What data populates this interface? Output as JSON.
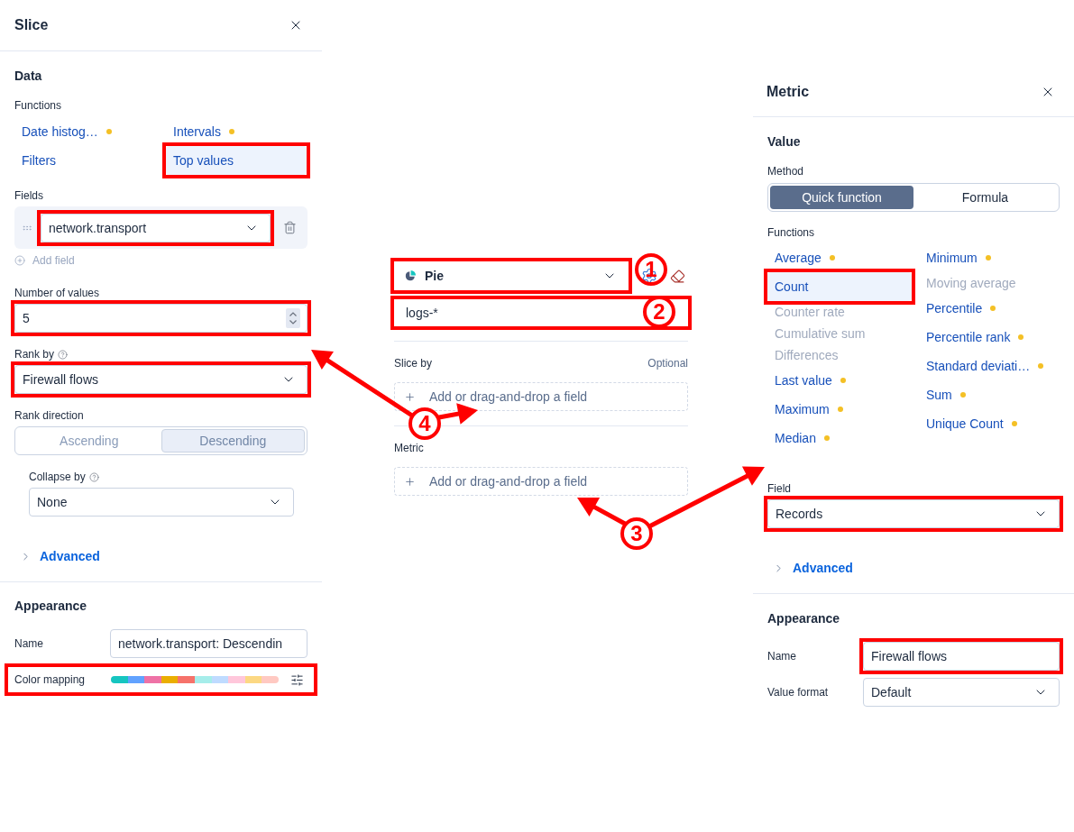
{
  "slice_panel": {
    "title": "Slice",
    "data_heading": "Data",
    "functions_label": "Functions",
    "functions": [
      {
        "label": "Date histog…",
        "dot": true,
        "selected": false,
        "highlighted": false
      },
      {
        "label": "Intervals",
        "dot": true,
        "selected": false,
        "highlighted": false
      },
      {
        "label": "Filters",
        "dot": false,
        "selected": false,
        "highlighted": false
      },
      {
        "label": "Top values",
        "dot": false,
        "selected": true,
        "highlighted": true
      }
    ],
    "fields_label": "Fields",
    "field": {
      "value": "network.transport",
      "highlighted": true
    },
    "add_field": "Add field",
    "number_of_values": {
      "label": "Number of values",
      "value": "5",
      "highlighted": true
    },
    "rank_by": {
      "label": "Rank by",
      "value": "Firewall flows",
      "highlighted": true
    },
    "rank_direction": {
      "label": "Rank direction",
      "disabled": true,
      "options": [
        {
          "label": "Ascending",
          "selected": false
        },
        {
          "label": "Descending",
          "selected": true
        }
      ]
    },
    "collapse_by": {
      "label": "Collapse by",
      "value": "None"
    },
    "advanced": {
      "label": "Advanced",
      "expanded": false
    },
    "appearance_heading": "Appearance",
    "name": {
      "label": "Name",
      "value": "network.transport: Descendin"
    },
    "color_mapping": {
      "label": "Color mapping",
      "highlighted": true,
      "palette": [
        {
          "color": "#16c5c0"
        },
        {
          "color": "#61a2ff"
        },
        {
          "color": "#ee72a6"
        },
        {
          "color": "#eaae01"
        },
        {
          "color": "#f6726a"
        },
        {
          "color": "#a6edea"
        },
        {
          "color": "#bfdbff"
        },
        {
          "color": "#ffc7db"
        },
        {
          "color": "#fcd883"
        },
        {
          "color": "#ffc9c2"
        }
      ]
    }
  },
  "layer_panel": {
    "chart_type": {
      "label": "Pie",
      "highlighted": true
    },
    "data_view": {
      "value": "logs-*",
      "highlighted": true
    },
    "groups": [
      {
        "label": "Slice by",
        "hint": "Optional",
        "button": "Add or drag-and-drop a field"
      },
      {
        "label": "Metric",
        "button": "Add or drag-and-drop a field"
      }
    ]
  },
  "metric_panel": {
    "title": "Metric",
    "value_heading": "Value",
    "method_label": "Method",
    "methods": [
      {
        "label": "Quick function",
        "selected": true
      },
      {
        "label": "Formula",
        "selected": false
      }
    ],
    "functions_label": "Functions",
    "function_columns": [
      {
        "items": [
          {
            "label": "Average",
            "dot": true,
            "disabled": false,
            "selected": false,
            "highlighted": false
          },
          {
            "label": "Count",
            "dot": false,
            "disabled": false,
            "selected": true,
            "highlighted": true
          },
          {
            "label": "Counter rate",
            "dot": false,
            "disabled": true,
            "selected": false,
            "highlighted": false
          },
          {
            "label": "Cumulative sum",
            "dot": false,
            "disabled": true,
            "selected": false,
            "highlighted": false
          },
          {
            "label": "Differences",
            "dot": false,
            "disabled": true,
            "selected": false,
            "highlighted": false
          },
          {
            "label": "Last value",
            "dot": true,
            "disabled": false,
            "selected": false,
            "highlighted": false
          },
          {
            "label": "Maximum",
            "dot": true,
            "disabled": false,
            "selected": false,
            "highlighted": false
          },
          {
            "label": "Median",
            "dot": true,
            "disabled": false,
            "selected": false,
            "highlighted": false
          }
        ]
      },
      {
        "items": [
          {
            "label": "Minimum",
            "dot": true,
            "disabled": false,
            "selected": false,
            "highlighted": false
          },
          {
            "label": "Moving average",
            "dot": false,
            "disabled": true,
            "selected": false,
            "highlighted": false
          },
          {
            "label": "Percentile",
            "dot": true,
            "disabled": false,
            "selected": false,
            "highlighted": false
          },
          {
            "label": "Percentile rank",
            "dot": true,
            "disabled": false,
            "selected": false,
            "highlighted": false
          },
          {
            "label": "Standard deviati…",
            "dot": true,
            "disabled": false,
            "selected": false,
            "highlighted": false
          },
          {
            "label": "Sum",
            "dot": true,
            "disabled": false,
            "selected": false,
            "highlighted": false
          },
          {
            "label": "Unique Count",
            "dot": true,
            "disabled": false,
            "selected": false,
            "highlighted": false
          }
        ]
      }
    ],
    "field": {
      "label": "Field",
      "value": "Records",
      "highlighted": true
    },
    "advanced": {
      "label": "Advanced",
      "expanded": false
    },
    "appearance_heading": "Appearance",
    "name": {
      "label": "Name",
      "value": "Firewall flows",
      "highlighted": true
    },
    "value_format": {
      "label": "Value format",
      "value": "Default"
    }
  },
  "callouts": [
    {
      "number": "1"
    },
    {
      "number": "2"
    },
    {
      "number": "3"
    },
    {
      "number": "4"
    }
  ]
}
